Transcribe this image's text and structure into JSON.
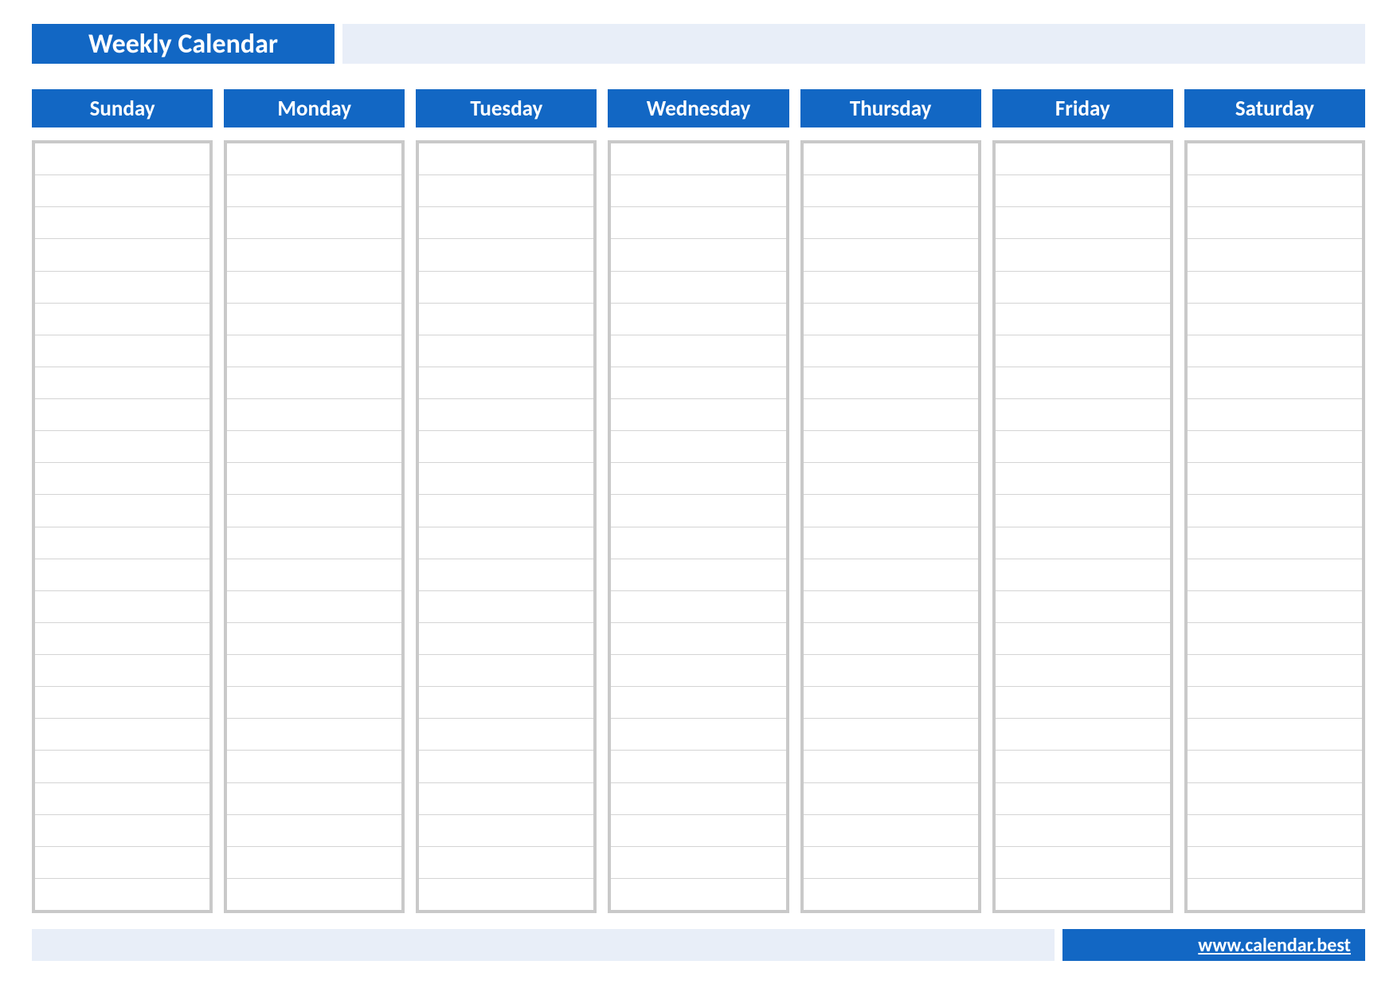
{
  "header": {
    "title": "Weekly Calendar"
  },
  "days": [
    {
      "label": "Sunday"
    },
    {
      "label": "Monday"
    },
    {
      "label": "Tuesday"
    },
    {
      "label": "Wednesday"
    },
    {
      "label": "Thursday"
    },
    {
      "label": "Friday"
    },
    {
      "label": "Saturday"
    }
  ],
  "rows_per_day": 24,
  "footer": {
    "link_text": "www.calendar.best"
  },
  "colors": {
    "primary": "#1267c4",
    "light": "#e8eef8",
    "border": "#c9c9c9",
    "row_border": "#d4d4d4"
  }
}
